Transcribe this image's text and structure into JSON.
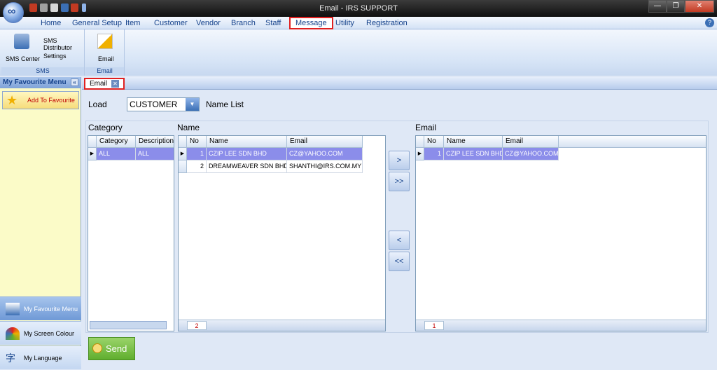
{
  "window": {
    "title": "Email - IRS SUPPORT"
  },
  "menu": {
    "items": [
      "Home",
      "General Setup",
      "Item",
      "Customer",
      "Vendor",
      "Branch",
      "Staff",
      "Message",
      "Utility",
      "Registration"
    ],
    "active": "Message"
  },
  "ribbon": {
    "sms_group": {
      "label": "SMS",
      "sms_center": "SMS Center",
      "sms_distributor": "SMS Distributor",
      "settings": "Settings"
    },
    "email_group": {
      "label": "Email",
      "email": "Email"
    }
  },
  "left_panel": {
    "title": "My Favourite Menu",
    "add_favourite": "Add To Favourite",
    "nav": [
      "My Favourite Menu",
      "My Screen Colour",
      "My Language"
    ]
  },
  "tab": {
    "label": "Email"
  },
  "form": {
    "load_label": "Load",
    "load_value": "CUSTOMER",
    "name_list_label": "Name List",
    "category_label": "Category",
    "name_label": "Name",
    "email_label": "Email",
    "send_label": "Send"
  },
  "category_grid": {
    "headers": [
      "Category",
      "Description"
    ],
    "rows": [
      [
        "ALL",
        "ALL"
      ]
    ]
  },
  "name_grid": {
    "headers": [
      "No",
      "Name",
      "Email"
    ],
    "rows": [
      [
        "1",
        "CZIP LEE SDN BHD",
        "CZ@YAHOO.COM"
      ],
      [
        "2",
        "DREAMWEAVER SDN BHD",
        "SHANTHI@IRS.COM.MY"
      ]
    ],
    "count": "2"
  },
  "email_grid": {
    "headers": [
      "No",
      "Name",
      "Email"
    ],
    "rows": [
      [
        "1",
        "CZIP LEE SDN BHD",
        "CZ@YAHOO.COM"
      ]
    ],
    "count": "1"
  },
  "move_buttons": [
    ">",
    ">>",
    "<",
    "<<"
  ]
}
